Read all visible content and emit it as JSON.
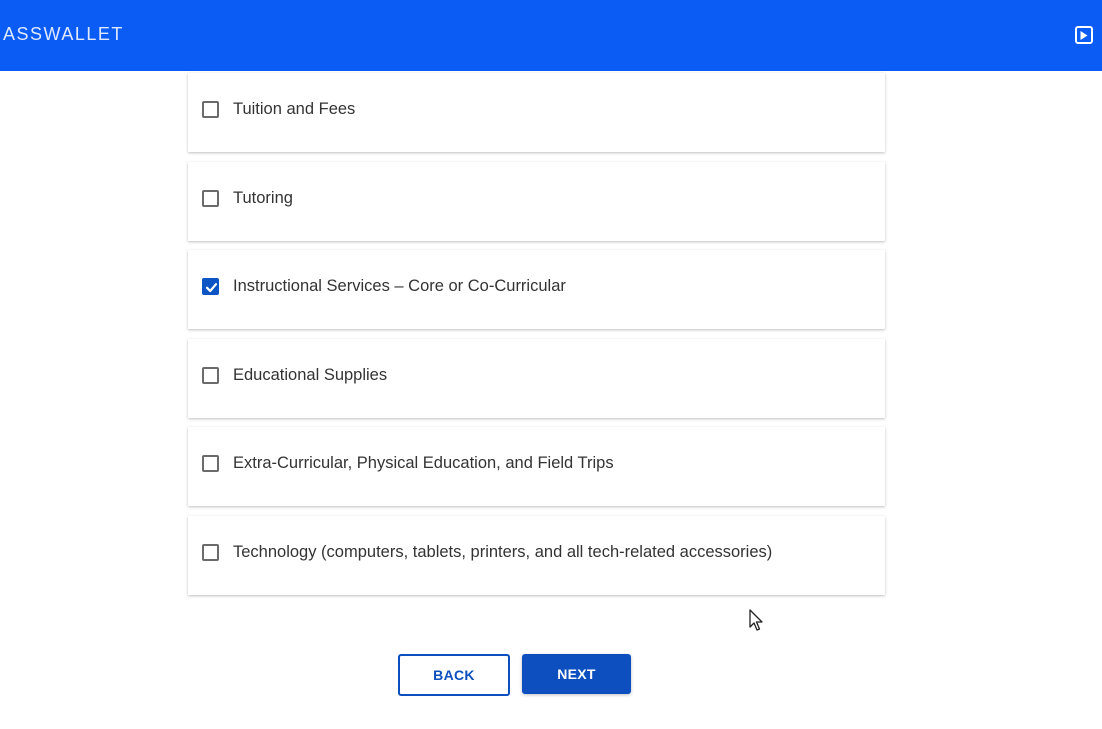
{
  "header": {
    "brand": "ASSWALLET",
    "exit_icon": "exit-box-icon",
    "background": "#0a5cf5"
  },
  "categories": [
    {
      "label": "Tuition and Fees",
      "checked": false
    },
    {
      "label": "Tutoring",
      "checked": false
    },
    {
      "label": "Instructional Services – Core or Co-Curricular",
      "checked": true
    },
    {
      "label": "Educational Supplies",
      "checked": false
    },
    {
      "label": "Extra-Curricular, Physical Education, and Field Trips",
      "checked": false
    },
    {
      "label": "Technology (computers, tablets, printers, and all tech-related accessories)",
      "checked": false
    }
  ],
  "buttons": {
    "back": "BACK",
    "next": "NEXT",
    "accent": "#0d4fbf"
  }
}
